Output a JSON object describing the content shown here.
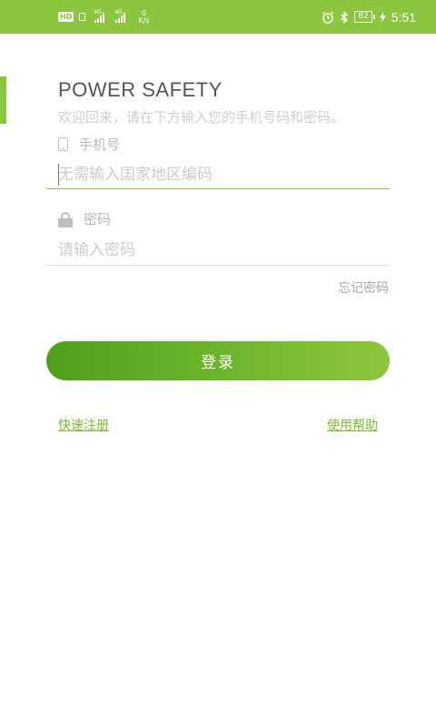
{
  "status_bar": {
    "hd_badge": "HD",
    "signal1_tag": "4G",
    "signal2_tag": "4G",
    "net_speed_value": "0",
    "net_speed_unit": "K/s",
    "battery": "82",
    "time": "5:51",
    "icons": [
      "hd-icon",
      "sim-icon",
      "signal-icon",
      "alarm-icon",
      "bluetooth-icon",
      "battery-icon",
      "charging-icon"
    ]
  },
  "login": {
    "title": "POWER SAFETY",
    "subtitle": "欢迎回来，请在下方输入您的手机号码和密码。",
    "phone": {
      "label": "手机号",
      "placeholder": "无需输入国家地区编码",
      "value": ""
    },
    "password": {
      "label": "密码",
      "placeholder": "请输入密码",
      "value": ""
    },
    "forgot_label": "忘记密码",
    "submit_label": "登录",
    "register_label": "快速注册",
    "help_label": "使用帮助"
  },
  "colors": {
    "brand": "#8cc63e",
    "brand_dark": "#4f9f1c",
    "link": "#7fb832",
    "active_underline": "#8cc63e",
    "inactive_underline": "#e3e3e3"
  }
}
